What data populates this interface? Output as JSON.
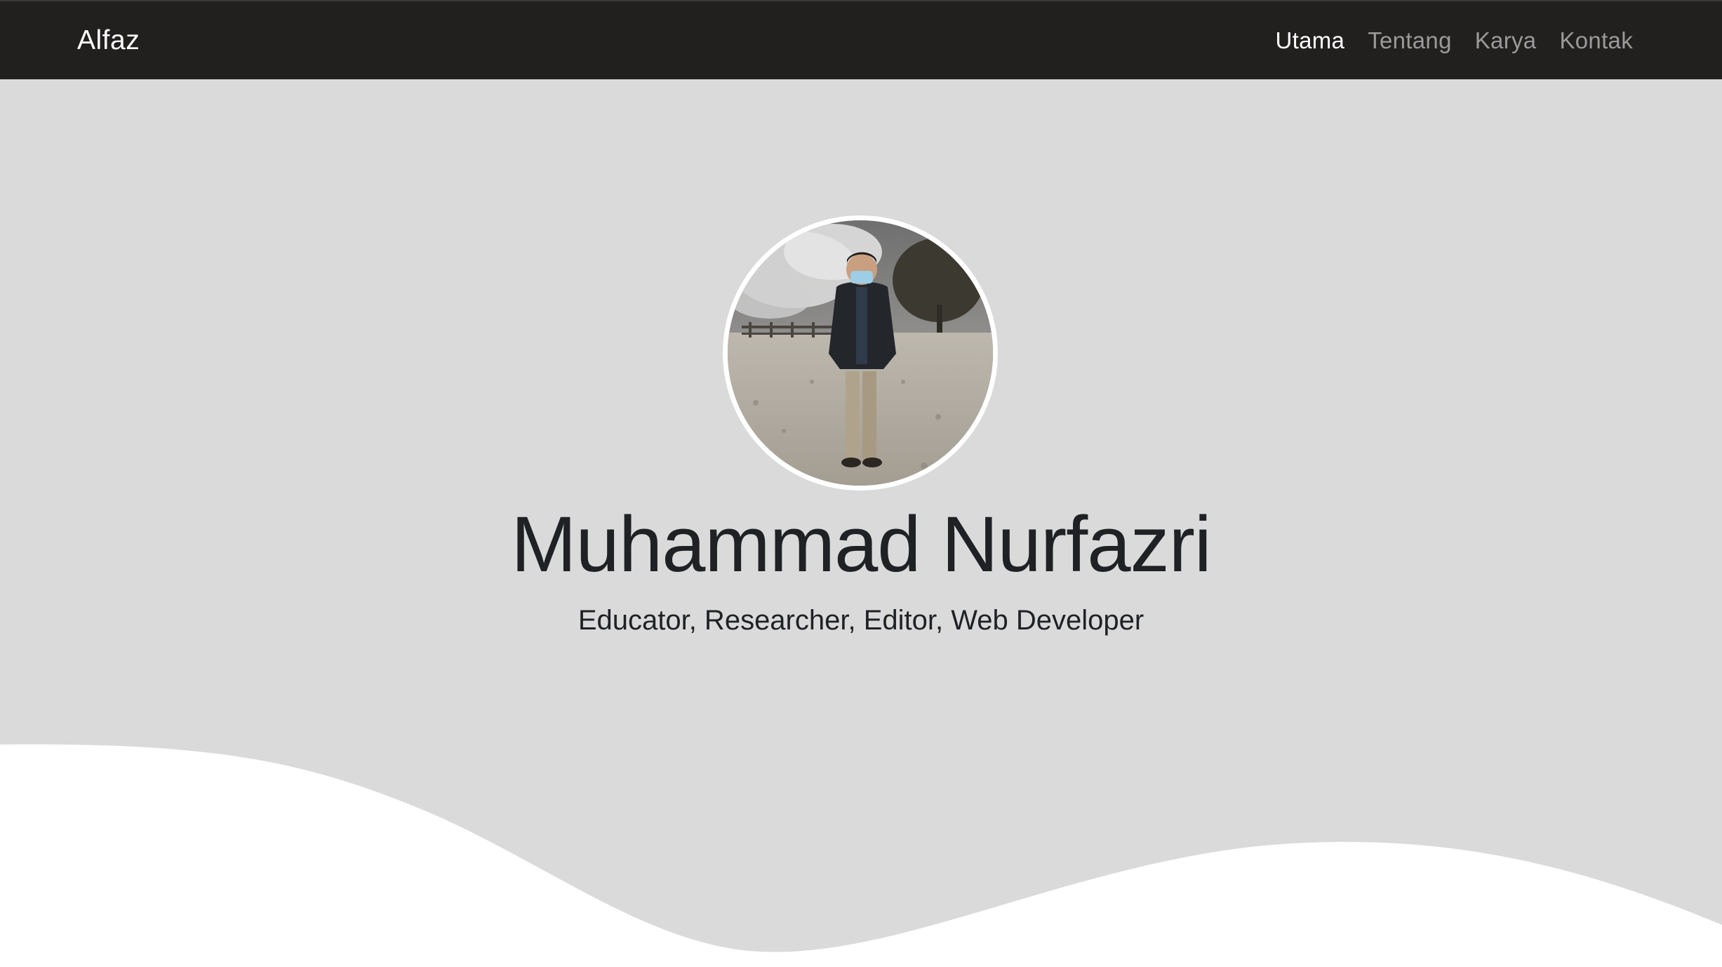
{
  "navbar": {
    "brand": "Alfaz",
    "links": [
      {
        "label": "Utama",
        "active": true
      },
      {
        "label": "Tentang",
        "active": false
      },
      {
        "label": "Karya",
        "active": false
      },
      {
        "label": "Kontak",
        "active": false
      }
    ]
  },
  "hero": {
    "name": "Muhammad Nurfazri",
    "tagline": "Educator, Researcher, Editor, Web Developer",
    "avatar_icon": "profile-photo"
  },
  "colors": {
    "navbar_bg": "#221f1f",
    "hero_bg": "#dadada",
    "wave": "#ffffff",
    "nav_active": "#ffffff",
    "nav_inactive": "#9a9a9a",
    "text": "#1f2124"
  }
}
